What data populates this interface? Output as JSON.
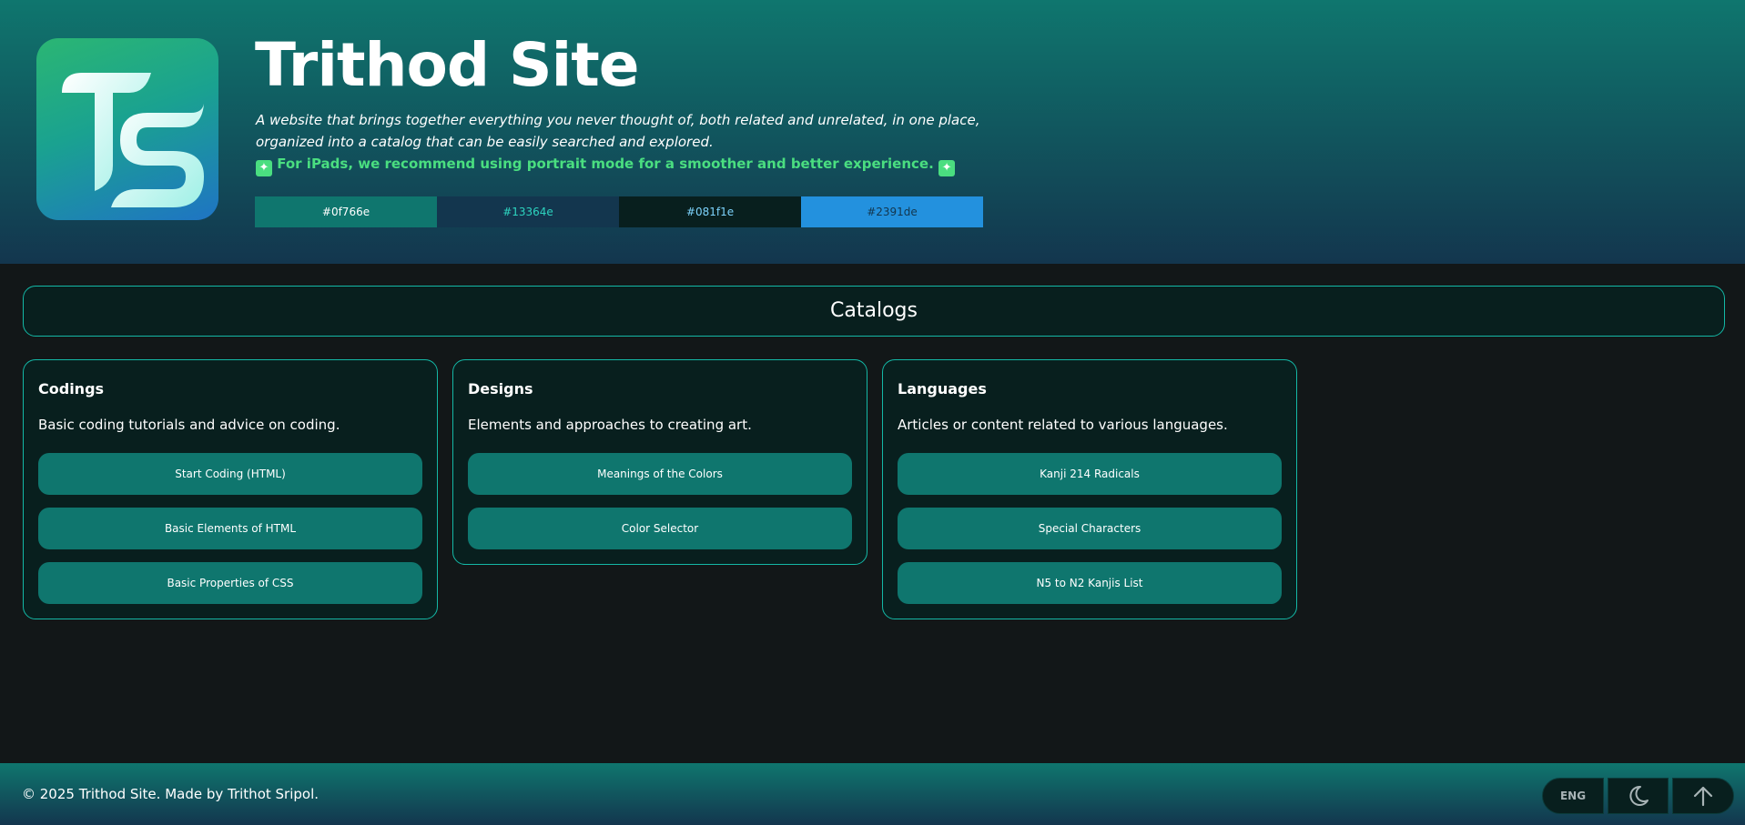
{
  "header": {
    "title": "Trithod Site",
    "tagline_line1": "A website that brings together everything you never thought of, both related and unrelated, in one place,",
    "tagline_line2": "organized into a catalog that can be easily searched and explored.",
    "notice": "For iPads, we recommend using portrait mode for a smoother and better experience.",
    "swatches": [
      {
        "label": "#0f766e",
        "bg": "#0f766e",
        "fg": "#ffffff"
      },
      {
        "label": "#13364e",
        "bg": "#13364e",
        "fg": "#2dd4bf"
      },
      {
        "label": "#081f1e",
        "bg": "#081f1e",
        "fg": "#7dd3fc"
      },
      {
        "label": "#2391de",
        "bg": "#2391de",
        "fg": "#13364e"
      }
    ]
  },
  "catalogs": {
    "heading": "Catalogs",
    "cards": [
      {
        "title": "Codings",
        "description": "Basic coding tutorials and advice on coding.",
        "links": [
          "Start Coding (HTML)",
          "Basic Elements of HTML",
          "Basic Properties of CSS"
        ]
      },
      {
        "title": "Designs",
        "description": "Elements and approaches to creating art.",
        "links": [
          "Meanings of the Colors",
          "Color Selector"
        ]
      },
      {
        "title": "Languages",
        "description": "Articles or content related to various languages.",
        "links": [
          "Kanji 214 Radicals",
          "Special Characters",
          "N5 to N2 Kanjis List"
        ]
      }
    ]
  },
  "footer": {
    "copyright": "© 2025 Trithod Site. Made by Trithot Sripol.",
    "lang_label": "ENG",
    "theme_icon": "moon-icon",
    "top_icon": "arrow-up-icon"
  },
  "colors": {
    "accent": "#0f766e",
    "navy": "#13364e",
    "dark": "#081f1e",
    "blue": "#2391de",
    "notice_green": "#4ade80",
    "border_teal": "#14b8a6"
  }
}
